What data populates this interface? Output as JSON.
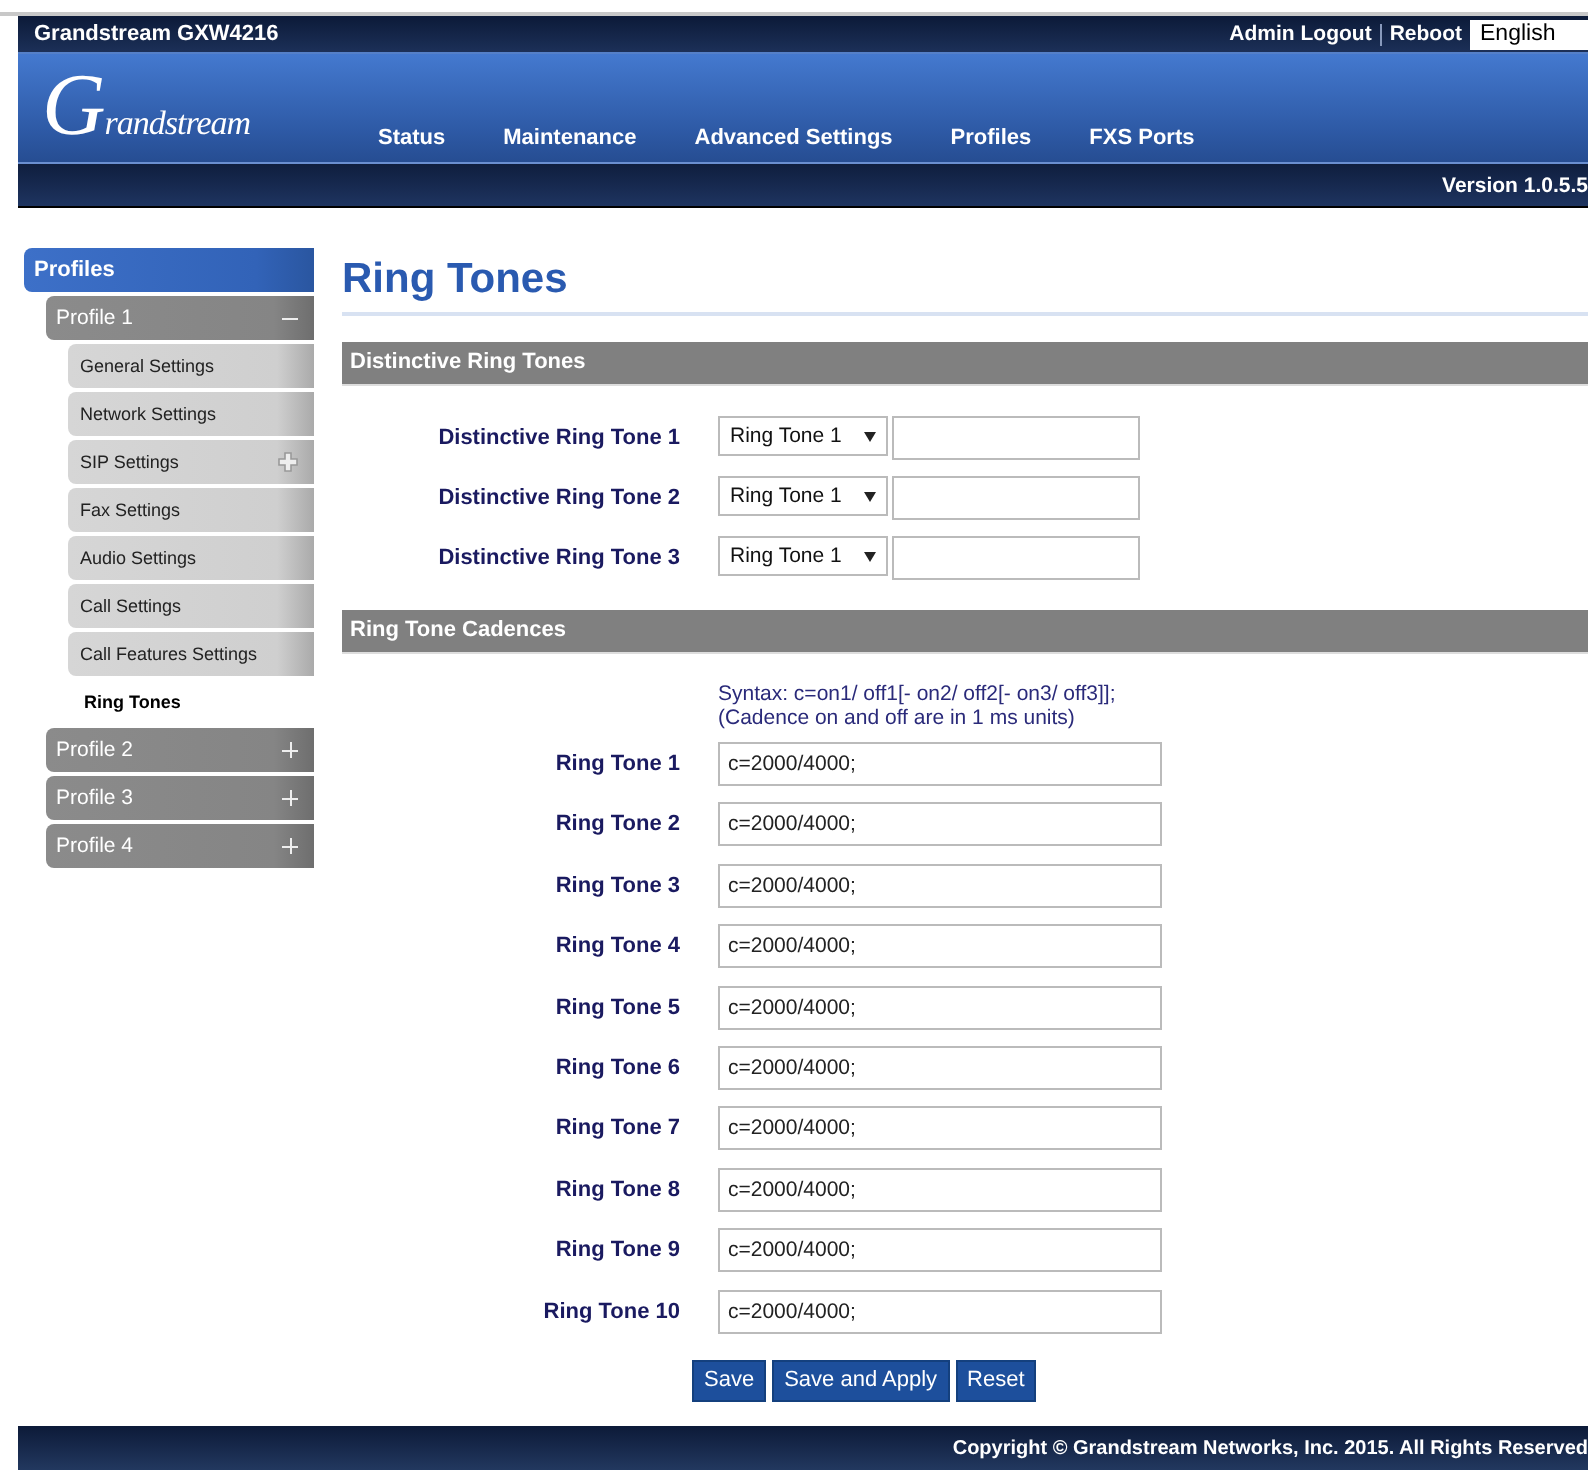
{
  "header": {
    "product": "Grandstream GXW4216",
    "links": [
      {
        "label": "Admin Logout"
      },
      {
        "label": "Reboot"
      }
    ],
    "language": "English"
  },
  "logo": "Grandstream",
  "nav": [
    {
      "label": "Status"
    },
    {
      "label": "Maintenance"
    },
    {
      "label": "Advanced Settings"
    },
    {
      "label": "Profiles"
    },
    {
      "label": "FXS Ports"
    }
  ],
  "version": "Version 1.0.5.5",
  "sidebar": {
    "title": "Profiles",
    "items": [
      {
        "label": "Profile 1",
        "expanded": true,
        "children": [
          {
            "label": "General Settings",
            "selected": false,
            "has_submenu": false
          },
          {
            "label": "Network Settings",
            "selected": false,
            "has_submenu": false
          },
          {
            "label": "SIP Settings",
            "selected": false,
            "has_submenu": true
          },
          {
            "label": "Fax Settings",
            "selected": false,
            "has_submenu": false
          },
          {
            "label": "Audio Settings",
            "selected": false,
            "has_submenu": false
          },
          {
            "label": "Call Settings",
            "selected": false,
            "has_submenu": false
          },
          {
            "label": "Call Features Settings",
            "selected": false,
            "has_submenu": false
          },
          {
            "label": "Ring Tones",
            "selected": true,
            "has_submenu": false
          }
        ]
      },
      {
        "label": "Profile 2",
        "expanded": false
      },
      {
        "label": "Profile 3",
        "expanded": false
      },
      {
        "label": "Profile 4",
        "expanded": false
      }
    ]
  },
  "page_title": "Ring Tones",
  "sections": [
    {
      "title": "Distinctive Ring Tones",
      "kind": "distinctive",
      "rows": [
        {
          "label": "Distinctive Ring Tone 1",
          "select": "Ring Tone 1"
        },
        {
          "label": "Distinctive Ring Tone 2",
          "select": "Ring Tone 1"
        },
        {
          "label": "Distinctive Ring Tone 3",
          "select": "Ring Tone 1"
        }
      ]
    },
    {
      "title": "Ring Tone Cadences",
      "kind": "cadence",
      "note": [
        "Syntax: c=on1/ off1[- on2/ off2[- on3/ off3]];",
        "(Cadence on and off are in 1 ms units)"
      ],
      "rows": [
        {
          "label": "Ring Tone 1",
          "value": "c=2000/4000;"
        },
        {
          "label": "Ring Tone 2",
          "value": "c=2000/4000;"
        },
        {
          "label": "Ring Tone 3",
          "value": "c=2000/4000;"
        },
        {
          "label": "Ring Tone 4",
          "value": "c=2000/4000;"
        },
        {
          "label": "Ring Tone 5",
          "value": "c=2000/4000;"
        },
        {
          "label": "Ring Tone 6",
          "value": "c=2000/4000;"
        },
        {
          "label": "Ring Tone 7",
          "value": "c=2000/4000;"
        },
        {
          "label": "Ring Tone 8",
          "value": "c=2000/4000;"
        },
        {
          "label": "Ring Tone 9",
          "value": "c=2000/4000;"
        },
        {
          "label": "Ring Tone 10",
          "value": "c=2000/4000;"
        }
      ]
    }
  ],
  "buttons": [
    {
      "label": "Save"
    },
    {
      "label": "Save and Apply"
    },
    {
      "label": "Reset"
    }
  ],
  "footer": "Copyright © Grandstream Networks, Inc. 2015. All Rights Reserved"
}
